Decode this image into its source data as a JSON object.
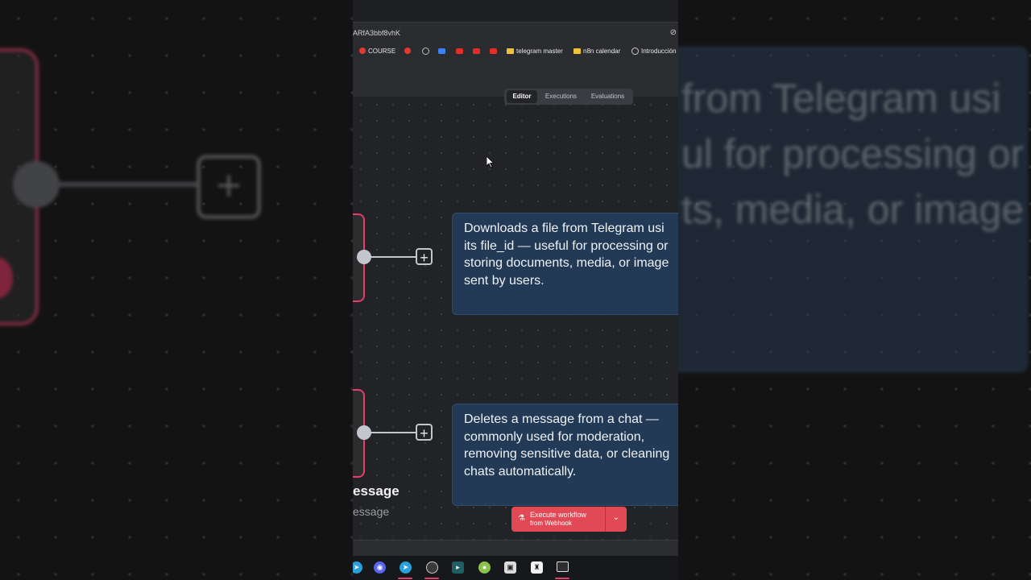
{
  "browser": {
    "url_fragment": "ARfA3bbf8vhK",
    "bookmarks": [
      "COURSE",
      "telegram master",
      "n8n calendar",
      "Introducción"
    ]
  },
  "editor": {
    "tabs": [
      "Editor",
      "Executions",
      "Evaluations"
    ],
    "active_tab": "Editor"
  },
  "notes": [
    {
      "lines": [
        "Downloads a file from Telegram usi",
        "its file_id — useful for processing or",
        "storing documents, media, or image",
        "sent by users."
      ]
    },
    {
      "lines": [
        "Deletes a message from a chat —",
        "commonly used for moderation,",
        "removing sensitive data, or cleaning",
        "chats automatically."
      ]
    }
  ],
  "node_labels": {
    "title": "essage",
    "subtitle": "essage"
  },
  "execute_button": {
    "line1": "Execute workflow",
    "line2": "from Webhook"
  },
  "background_right": {
    "lines": [
      "from Telegram usi",
      "ul for processing or",
      "ts, media, or image"
    ]
  },
  "colors": {
    "accent": "#e24955",
    "node_border": "#e0406a",
    "note_bg": "#233a56",
    "canvas_bg": "#222326"
  },
  "taskbar_icons": [
    "telegram-icon",
    "discord-icon",
    "telegram-icon",
    "obs-icon",
    "app-icon",
    "android-icon",
    "screenshot-icon",
    "app-icon",
    "terminal-icon"
  ]
}
